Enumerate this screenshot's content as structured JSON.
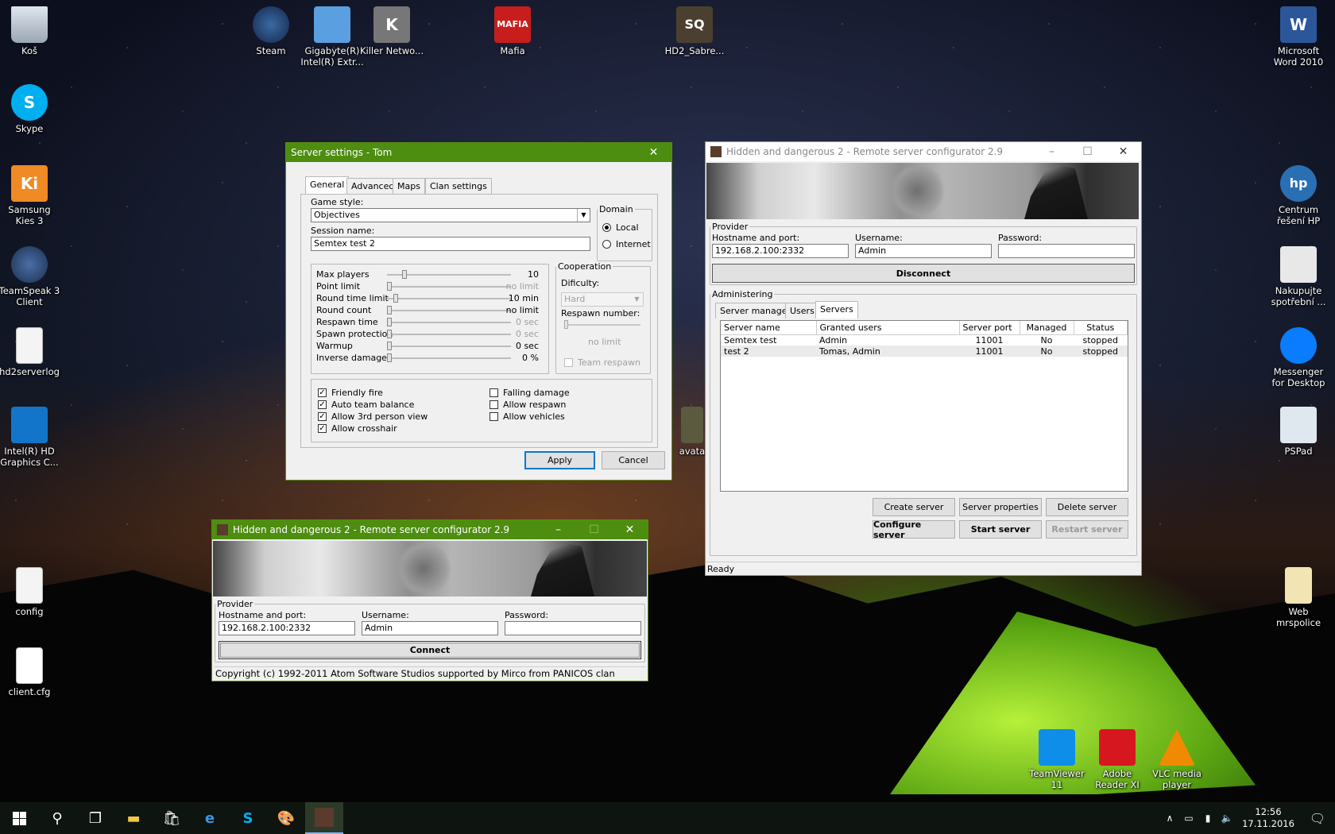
{
  "desktop": {
    "icons_left": [
      {
        "name": "recycle-bin-icon",
        "label": "Koš"
      },
      {
        "name": "skype-icon",
        "label": "Skype"
      },
      {
        "name": "samsung-kies-icon",
        "label": "Samsung Kies 3"
      },
      {
        "name": "teamspeak-icon",
        "label": "TeamSpeak 3 Client"
      },
      {
        "name": "text-file-icon",
        "label": "hd2serverlog"
      },
      {
        "name": "intel-graphics-icon",
        "label": "Intel(R) HD Graphics C..."
      },
      {
        "name": "config-file-icon",
        "label": "config"
      },
      {
        "name": "cfg-file-icon",
        "label": "client.cfg"
      }
    ],
    "icons_top": [
      {
        "name": "steam-icon",
        "label": "Steam"
      },
      {
        "name": "gigabyte-icon",
        "label": "Gigabyte(R) Intel(R) Extr..."
      },
      {
        "name": "killer-network-icon",
        "label": "Killer Netwo..."
      },
      {
        "name": "mafia-icon",
        "label": "Mafia"
      },
      {
        "name": "hd2-sabre-icon",
        "label": "HD2_Sabre..."
      }
    ],
    "icons_right": [
      {
        "name": "word-icon",
        "label": "Microsoft Word 2010"
      },
      {
        "name": "hp-center-icon",
        "label": "Centrum řešení HP"
      },
      {
        "name": "hp-shopping-icon",
        "label": "Nakupujte spotřební ..."
      },
      {
        "name": "messenger-icon",
        "label": "Messenger for Desktop"
      },
      {
        "name": "pspad-icon",
        "label": "PSPad"
      },
      {
        "name": "web-folder-icon",
        "label": "Web mrspolice"
      }
    ],
    "icons_bottom": [
      {
        "name": "teamviewer-icon",
        "label": "TeamViewer 11"
      },
      {
        "name": "adobe-reader-icon",
        "label": "Adobe Reader XI"
      },
      {
        "name": "vlc-icon",
        "label": "VLC media player"
      }
    ],
    "partial_icon_label": "avata"
  },
  "server_settings": {
    "title": "Server settings - Tom",
    "tabs": [
      "General",
      "Advanced",
      "Maps",
      "Clan settings"
    ],
    "game_style_label": "Game style:",
    "game_style_value": "Objectives",
    "session_name_label": "Session name:",
    "session_name_value": "Semtex test 2",
    "domain_legend": "Domain",
    "domain_local": "Local",
    "domain_internet": "Internet",
    "sliders": [
      {
        "label": "Max players",
        "value": "10",
        "level": 0.12,
        "enabled": true
      },
      {
        "label": "Point limit",
        "value": "no limit",
        "level": 0,
        "enabled": false
      },
      {
        "label": "Round time limit",
        "value": "10 min",
        "level": 0.05,
        "enabled": true
      },
      {
        "label": "Round count",
        "value": "no limit",
        "level": 0,
        "enabled": true
      },
      {
        "label": "Respawn time",
        "value": "0 sec",
        "level": 0,
        "enabled": false
      },
      {
        "label": "Spawn protection",
        "value": "0 sec",
        "level": 0,
        "enabled": false
      },
      {
        "label": "Warmup",
        "value": "0 sec",
        "level": 0,
        "enabled": true
      },
      {
        "label": "Inverse damage",
        "value": "0 %",
        "level": 0,
        "enabled": true
      }
    ],
    "coop_legend": "Cooperation",
    "difficulty_label": "Dificulty:",
    "difficulty_value": "Hard",
    "respawn_number_label": "Respawn number:",
    "respawn_number_value": "no limit",
    "team_respawn_label": "Team respawn",
    "checkboxes_left": [
      {
        "label": "Friendly fire",
        "checked": true
      },
      {
        "label": "Auto team balance",
        "checked": true
      },
      {
        "label": "Allow 3rd person view",
        "checked": true
      },
      {
        "label": "Allow crosshair",
        "checked": true
      }
    ],
    "checkboxes_right": [
      {
        "label": "Falling damage",
        "checked": false
      },
      {
        "label": "Allow respawn",
        "checked": false
      },
      {
        "label": "Allow vehicles",
        "checked": false
      }
    ],
    "apply_label": "Apply",
    "cancel_label": "Cancel"
  },
  "configurator_main": {
    "title": "Hidden and dangerous 2 - Remote server configurator 2.9",
    "provider_legend": "Provider",
    "hostname_label": "Hostname and port:",
    "hostname_value": "192.168.2.100:2332",
    "username_label": "Username:",
    "username_value": "Admin",
    "password_label": "Password:",
    "password_value": "",
    "disconnect_label": "Disconnect",
    "admin_legend": "Administering",
    "tabs": [
      "Server manager",
      "Users",
      "Servers"
    ],
    "columns": [
      "Server name",
      "Granted users",
      "Server port",
      "Managed",
      "Status"
    ],
    "rows": [
      [
        "Semtex test",
        "Admin",
        "11001",
        "No",
        "stopped"
      ],
      [
        "test 2",
        "Tomas, Admin",
        "11001",
        "No",
        "stopped"
      ]
    ],
    "buttons_row1": [
      "Create server",
      "Server properties",
      "Delete server"
    ],
    "buttons_row2": [
      "Configure server",
      "Start server",
      "Restart server"
    ],
    "status": "Ready"
  },
  "configurator_small": {
    "title": "Hidden and dangerous 2 - Remote server configurator 2.9",
    "provider_legend": "Provider",
    "hostname_label": "Hostname and port:",
    "hostname_value": "192.168.2.100:2332",
    "username_label": "Username:",
    "username_value": "Admin",
    "password_label": "Password:",
    "password_value": "",
    "connect_label": "Connect",
    "copyright": "Copyright (c) 1992-2011 Atom Software Studios supported by Mirco from PANICOS clan"
  },
  "taskbar": {
    "time": "12:56",
    "date": "17.11.2016"
  },
  "colors": {
    "title_active": "#4d8d0f",
    "accent": "#0078d7"
  }
}
